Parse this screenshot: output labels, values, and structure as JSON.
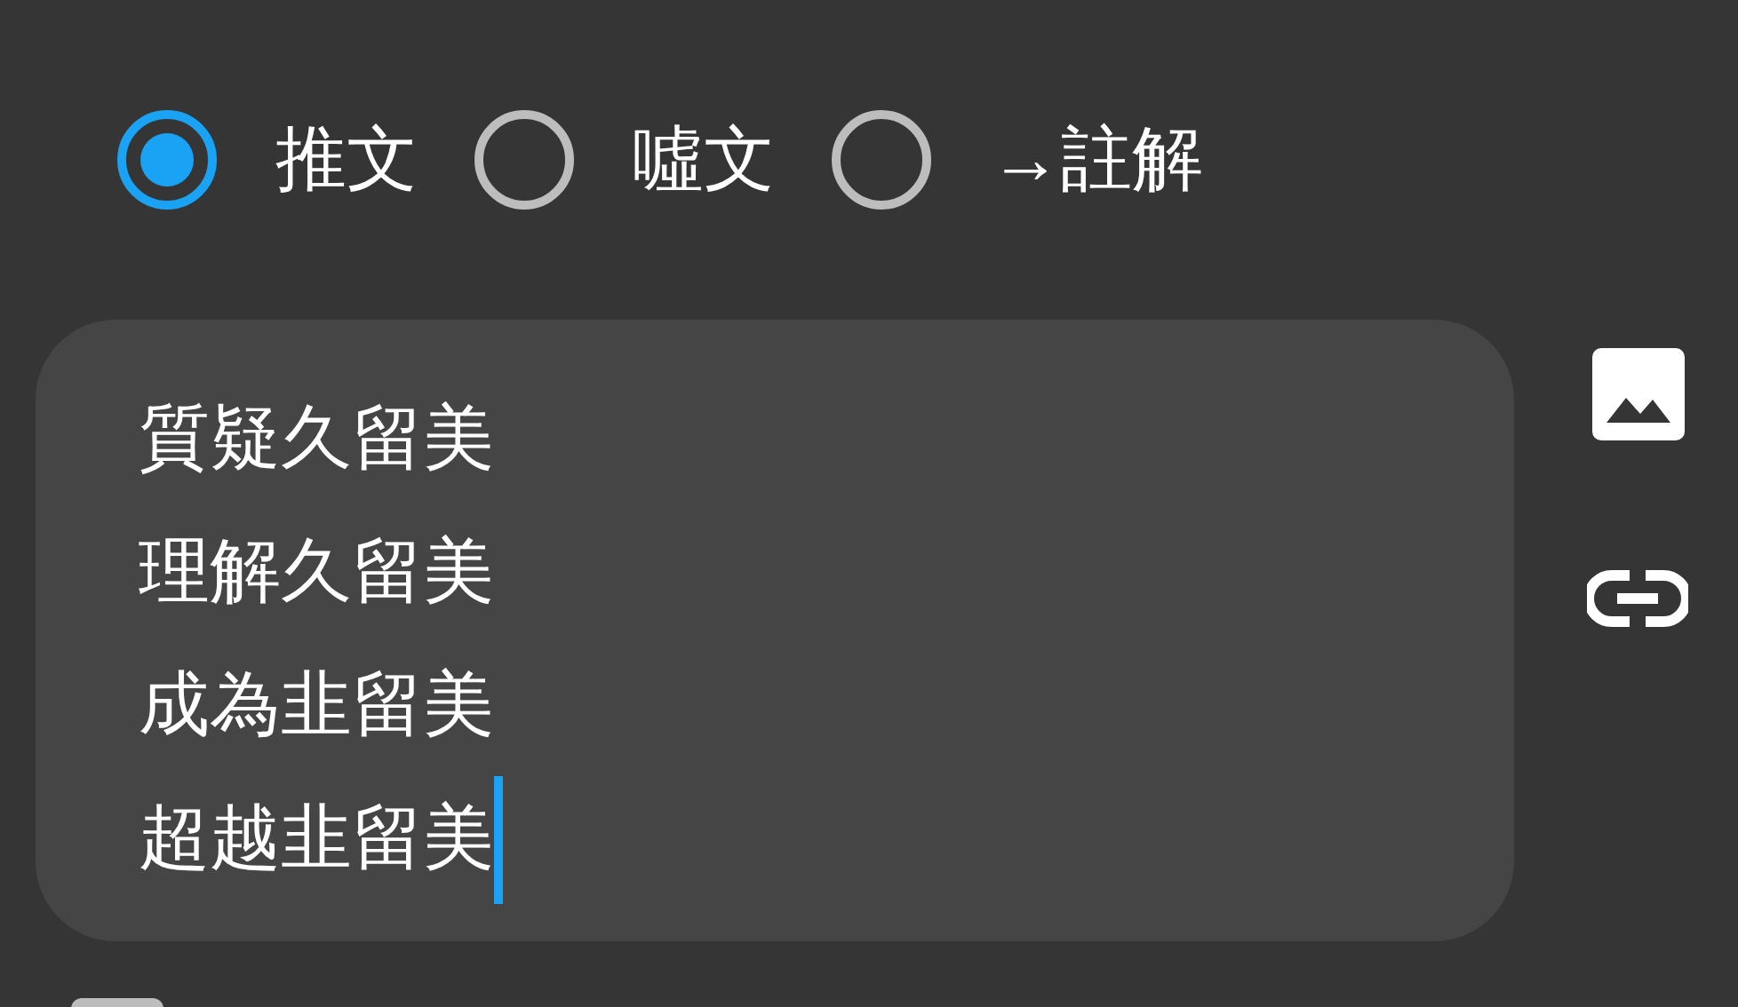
{
  "post_type": [
    {
      "label": "推文",
      "selected": true
    },
    {
      "label": "噓文",
      "selected": false
    },
    {
      "label": "→註解",
      "selected": false
    }
  ],
  "editor": {
    "lines": [
      "質疑久留美",
      "理解久留美",
      "成為韭留美",
      "超越韭留美"
    ]
  }
}
